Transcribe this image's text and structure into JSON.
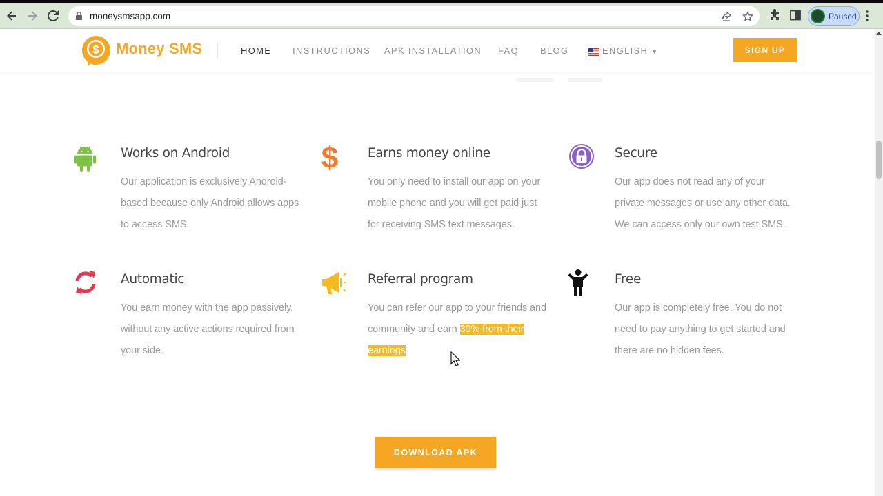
{
  "browser": {
    "url": "moneysmsapp.com",
    "profile_label": "Paused"
  },
  "site": {
    "logo_text": "Money SMS",
    "nav": [
      {
        "label": "HOME",
        "active": true
      },
      {
        "label": "INSTRUCTIONS"
      },
      {
        "label": "APK INSTALLATION"
      },
      {
        "label": "FAQ"
      },
      {
        "label": "BLOG"
      },
      {
        "label": "ENGLISH"
      }
    ],
    "signup_label": "SIGN UP"
  },
  "features": [
    {
      "icon": "android-icon",
      "title": "Works on Android",
      "desc": [
        "Our application is exclusively Android-",
        "based because only Android allows apps",
        "to access SMS."
      ]
    },
    {
      "icon": "dollar-icon",
      "title": "Earns money online",
      "desc": [
        "You only need to install our app on your",
        "mobile phone and you will get paid just",
        "for receiving SMS text messages."
      ]
    },
    {
      "icon": "lock-icon",
      "title": "Secure",
      "desc": [
        "Our app does not read any of your",
        "private messages or use any other data.",
        "We can access only our own test SMS."
      ]
    },
    {
      "icon": "refresh-icon",
      "title": "Automatic",
      "desc": [
        "You earn money with the app passively,",
        "without any active actions required from",
        "your side."
      ]
    },
    {
      "icon": "megaphone-icon",
      "title": "Referral program",
      "desc_parts": {
        "line1": "You can refer our app to your friends and",
        "line2_plain": "community and earn ",
        "line2_highlight": "30% from their",
        "line3_highlight": "earnings"
      }
    },
    {
      "icon": "person-icon",
      "title": "Free",
      "desc": [
        "Our app is completely free. You do not",
        "need to pay anything to get started and",
        "there are no hidden fees."
      ]
    }
  ],
  "download_label": "DOWNLOAD APK",
  "colors": {
    "accent": "#f5a623",
    "android": "#7cc243",
    "dollar": "#f07d2e",
    "lock": "#8b5fc8",
    "refresh": "#e8374d",
    "megaphone": "#f5b921"
  }
}
